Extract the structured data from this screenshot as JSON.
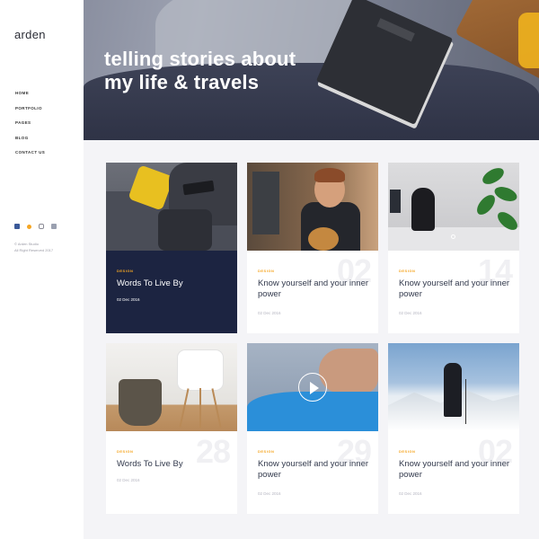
{
  "sidebar": {
    "brand": "arden",
    "nav": [
      "HOME",
      "PORTFOLIO",
      "PAGES",
      "BLOG",
      "CONTACT US"
    ],
    "social_icons": [
      "facebook-icon",
      "twitter-icon",
      "instagram-icon",
      "youtube-icon"
    ],
    "copyright_line1": "© Arden Studio",
    "copyright_line2": "All Right Reserved 2017"
  },
  "hero": {
    "title_line1": "telling stories about",
    "title_line2": "my life & travels"
  },
  "posts": [
    {
      "category": "DESIGN",
      "title": "Words To Live By",
      "date": "02 Dec 2016",
      "number": ""
    },
    {
      "category": "DESIGN",
      "title": "Know yourself and your inner power",
      "date": "02 Dec 2016",
      "number": "02"
    },
    {
      "category": "DESIGN",
      "title": "Know yourself and your inner power",
      "date": "02 Dec 2016",
      "number": "14"
    },
    {
      "category": "DESIGN",
      "title": "Words To Live By",
      "date": "02 Dec 2016",
      "number": "28"
    },
    {
      "category": "DESIGN",
      "title": "Know yourself and your inner power",
      "date": "02 Dec 2016",
      "number": "29"
    },
    {
      "category": "DESIGN",
      "title": "Know yourself and your inner power",
      "date": "02 Dec 2016",
      "number": "02"
    }
  ],
  "colors": {
    "accent": "#f5a623",
    "dark_card": "#1c2441",
    "text": "#333a4d"
  }
}
